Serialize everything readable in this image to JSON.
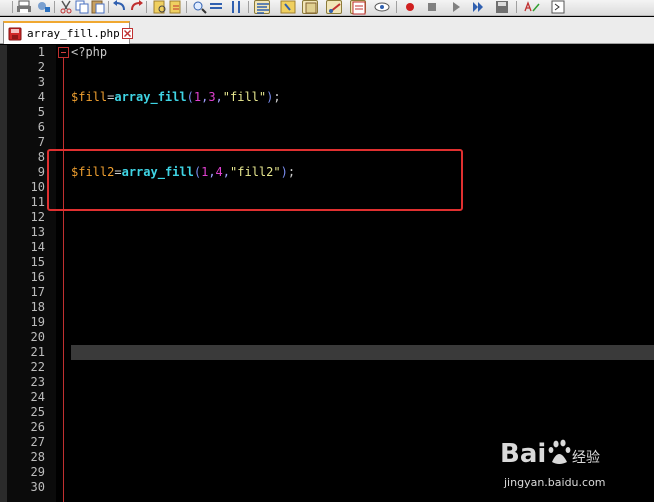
{
  "tab": {
    "label": "array_fill.php"
  },
  "editor": {
    "line_numbers": [
      "1",
      "2",
      "3",
      "4",
      "5",
      "6",
      "7",
      "8",
      "9",
      "10",
      "11",
      "12",
      "13",
      "14",
      "15",
      "16",
      "17",
      "18",
      "19",
      "20",
      "21",
      "22",
      "23",
      "24",
      "25",
      "26",
      "27",
      "28",
      "29",
      "30"
    ],
    "current_line": 21,
    "code": {
      "line1": {
        "open_tag": "<?php"
      },
      "line4": {
        "var": "$fill",
        "op": "=",
        "fn": "array_fill",
        "open": "(",
        "a1": "1",
        "c1": ",",
        "a2": "3",
        "c2": ",",
        "str": "\"fill\"",
        "close": ")",
        "end": ";"
      },
      "line9": {
        "var": "$fill2",
        "op": "=",
        "fn": "array_fill",
        "open": "(",
        "a1": "1",
        "c1": ",",
        "a2": "4",
        "c2": ",",
        "str": "\"fill2\"",
        "close": ")",
        "end": ";"
      }
    }
  },
  "colors": {
    "background": "#000000",
    "variable": "#f0a030",
    "function": "#3fd4e4",
    "number": "#e040d0",
    "string": "#e8e890",
    "highlight_box": "#e03030",
    "current_line": "#3a3a3a"
  },
  "watermark": {
    "logo": "Bai du 经验",
    "url": "jingyan.baidu.com"
  },
  "toolbar": {
    "icons": [
      "print-icon",
      "replace-icon",
      "cut-icon",
      "copy-icon",
      "paste-icon",
      "undo-icon",
      "redo-icon",
      "find-icon",
      "find-replace-icon",
      "zoom-in-icon",
      "zoom-out-icon",
      "sync-vertical-icon",
      "sync-horizontal-icon",
      "word-wrap-icon",
      "show-all-chars-icon",
      "indent-guide-icon",
      "language-icon",
      "doc-map-icon",
      "function-list-icon",
      "monitor-icon",
      "record-macro-icon",
      "stop-macro-icon",
      "play-macro-icon",
      "run-macro-icon",
      "save-macro-icon",
      "spellcheck-icon",
      "run-icon"
    ]
  }
}
